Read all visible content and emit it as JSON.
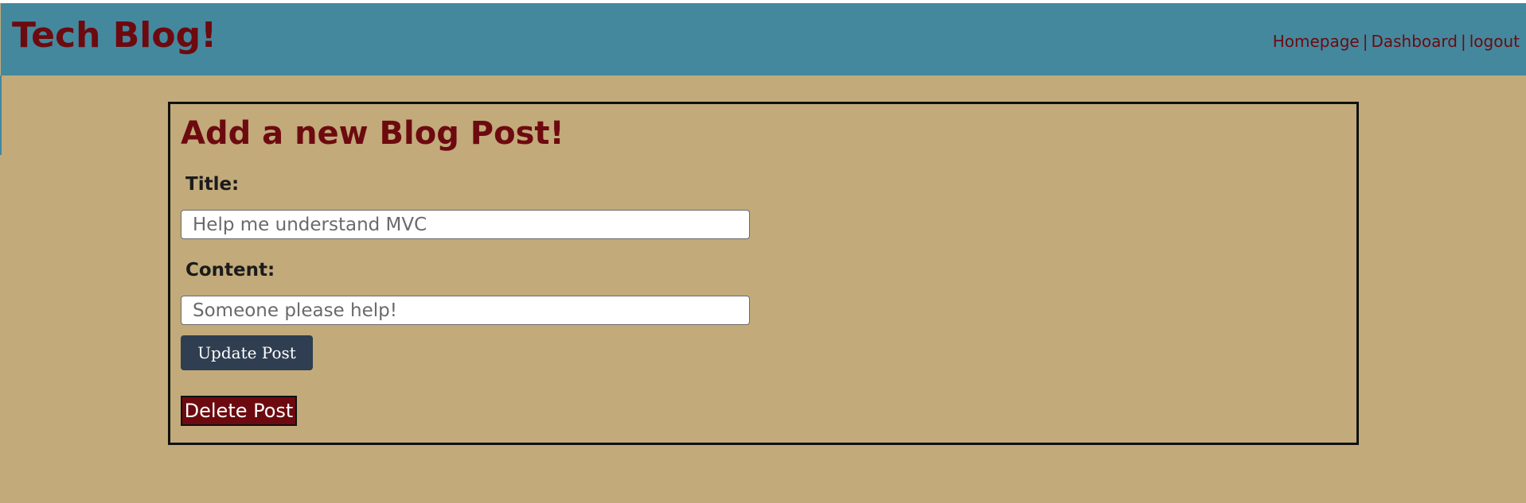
{
  "header": {
    "site_title": "Tech Blog!",
    "nav": {
      "homepage": "Homepage",
      "dashboard": "Dashboard",
      "logout": "logout",
      "separator": "|"
    }
  },
  "form": {
    "heading": "Add a new Blog Post!",
    "title_label": "Title:",
    "title_value": "Help me understand MVC",
    "content_label": "Content:",
    "content_value": "Someone please help!",
    "update_button": "Update Post",
    "delete_button": "Delete Post"
  },
  "colors": {
    "page_background": "#c2aa7a",
    "header_background": "#44889e",
    "accent": "#6d0a0f",
    "update_button": "#2f3e51"
  }
}
